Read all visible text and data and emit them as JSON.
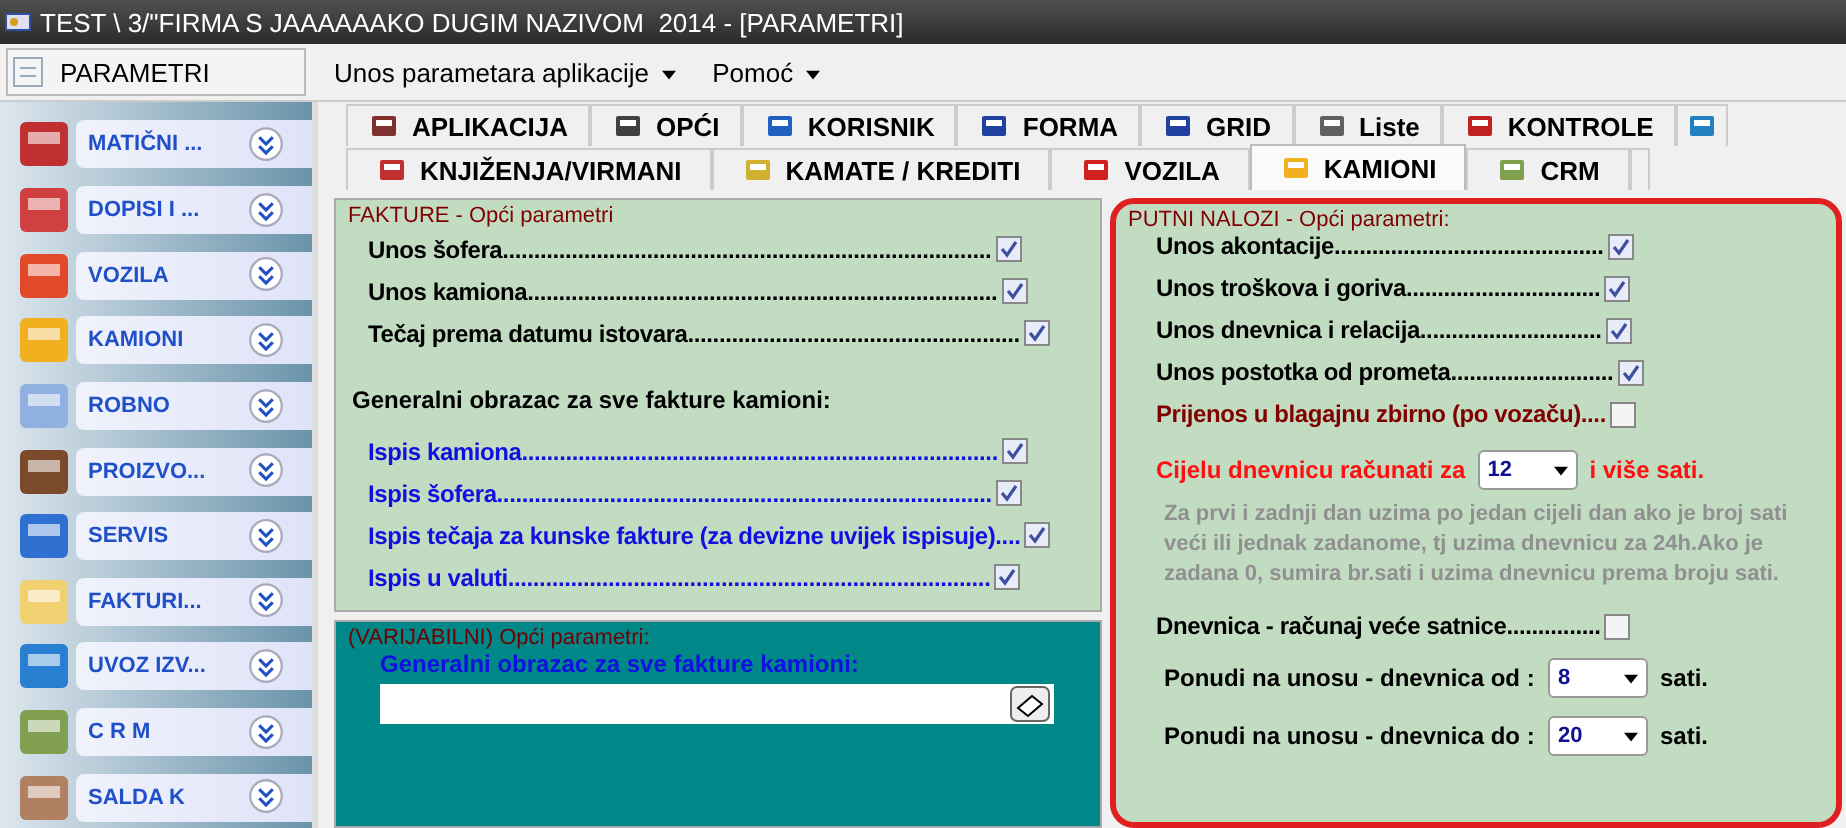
{
  "window": {
    "title": "TEST \\ 3/\"FIRMA S JAAAAAAKO DUGIM NAZIVOM  2014 - [PARAMETRI]"
  },
  "menu_bar": {
    "module": "PARAMETRI",
    "menus": [
      "Unos parametara aplikacije",
      "Pomoć"
    ]
  },
  "sidebar": {
    "items": [
      {
        "label": "MATIČNI ..."
      },
      {
        "label": "DOPISI I ..."
      },
      {
        "label": "VOZILA"
      },
      {
        "label": "KAMIONI"
      },
      {
        "label": "ROBNO"
      },
      {
        "label": "PROIZVO..."
      },
      {
        "label": "SERVIS"
      },
      {
        "label": "FAKTURI..."
      },
      {
        "label": "UVOZ IZV..."
      },
      {
        "label": "C R M"
      },
      {
        "label": "SALDA K"
      }
    ]
  },
  "tabs_row_1": [
    {
      "label": "APLIKACIJA",
      "selected": false
    },
    {
      "label": "OPĆI",
      "selected": false
    },
    {
      "label": "KORISNIK",
      "selected": false
    },
    {
      "label": "FORMA",
      "selected": false
    },
    {
      "label": "GRID",
      "selected": false
    },
    {
      "label": "Liste",
      "selected": false
    },
    {
      "label": "KONTROLE",
      "selected": false
    },
    {
      "selected": false
    }
  ],
  "tabs_row_2": [
    {
      "label": "KNJIŽENJA/VIRMANI",
      "selected": false
    },
    {
      "label": "KAMATE / KREDITI",
      "selected": false
    },
    {
      "label": "VOZILA",
      "selected": false
    },
    {
      "label": "KAMIONI",
      "selected": true
    },
    {
      "label": "CRM",
      "selected": false
    }
  ],
  "fakture": {
    "title": "FAKTURE - Opći parametri",
    "items": [
      {
        "kind": "checkbox",
        "label": "Unos šofera..............................................................................",
        "checked": true,
        "accent": false
      },
      {
        "kind": "checkbox",
        "label": "Unos kamiona...........................................................................",
        "checked": true,
        "accent": false
      },
      {
        "kind": "checkbox",
        "label": "Tečaj prema datumu istovara.....................................................",
        "checked": true,
        "accent": false
      },
      {
        "kind": "heading",
        "label": "Generalni obrazac za sve fakture kamioni:"
      },
      {
        "kind": "checkbox",
        "label": "Ispis kamiona............................................................................",
        "checked": true,
        "accent": true
      },
      {
        "kind": "checkbox",
        "label": "Ispis šofera...............................................................................",
        "checked": true,
        "accent": true
      },
      {
        "kind": "checkbox",
        "label": "Ispis tečaja za kunske fakture (za devizne uvijek ispisuje)....",
        "checked": true,
        "accent": true
      },
      {
        "kind": "checkbox",
        "label": "Ispis u valuti.............................................................................",
        "checked": true,
        "accent": true
      }
    ]
  },
  "varijabilni": {
    "title": "(VARIJABILNI) Opći parametri:",
    "field_label": "Generalni obrazac za sve fakture kamioni:"
  },
  "putni_nalozi": {
    "title": "PUTNI NALOZI - Opći parametri:",
    "items": [
      {
        "kind": "checkbox",
        "label": "Unos akontacije...........................................",
        "checked": true,
        "accent": false
      },
      {
        "kind": "checkbox",
        "label": "Unos troškova i goriva...............................",
        "checked": true,
        "accent": false
      },
      {
        "kind": "checkbox",
        "label": "Unos dnevnica i relacija.............................",
        "checked": true,
        "accent": false
      },
      {
        "kind": "checkbox",
        "label": "Unos postotka od prometa..........................",
        "checked": true,
        "accent": false
      },
      {
        "kind": "checkbox",
        "label": "Prijenos u blagajnu zbirno (po vozaču)....",
        "checked": false,
        "accent": true
      },
      {
        "kind": "select",
        "label": "Cijelu dnevnicu računati za",
        "value": "12",
        "suffix": "i više sati.",
        "accent": true
      },
      {
        "kind": "note",
        "label": "Za prvi i zadnji dan uzima  po jedan cijeli dan ako je broj sati veći ili jednak zadanome, tj uzima dnevnicu za 24h.Ako je zadana 0, sumira br.sati i uzima dnevnicu prema broju sati."
      },
      {
        "kind": "checkbox",
        "label": "Dnevnica - računaj veće satnice...............",
        "checked": false,
        "accent": false
      },
      {
        "kind": "select",
        "label": "Ponudi na unosu - dnevnica od :",
        "value": "8",
        "suffix": "sati.",
        "accent": false
      },
      {
        "kind": "select",
        "label": "Ponudi na unosu - dnevnica do :",
        "value": "20",
        "suffix": "sati.",
        "accent": false
      }
    ]
  }
}
